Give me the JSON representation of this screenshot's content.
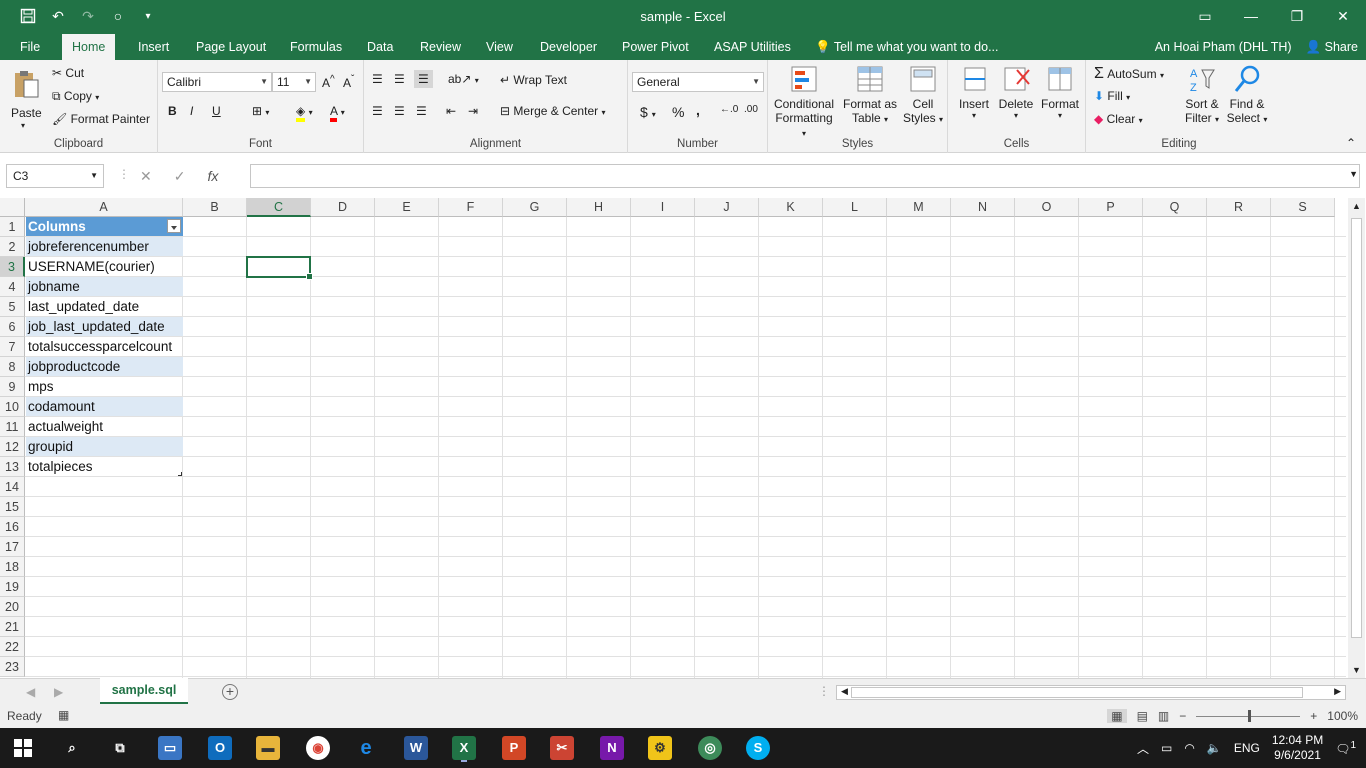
{
  "window": {
    "title": "sample - Excel"
  },
  "tabs": [
    "File",
    "Home",
    "Insert",
    "Page Layout",
    "Formulas",
    "Data",
    "Review",
    "View",
    "Developer",
    "Power Pivot",
    "ASAP Utilities"
  ],
  "tell_me": "Tell me what you want to do...",
  "user": "An Hoai Pham (DHL TH)",
  "share": "Share",
  "ribbon": {
    "clipboard": {
      "label": "Clipboard",
      "paste": "Paste",
      "cut": "Cut",
      "copy": "Copy",
      "format_painter": "Format Painter"
    },
    "font": {
      "label": "Font",
      "name": "Calibri",
      "size": "11",
      "bold": "B",
      "italic": "I",
      "underline": "U"
    },
    "alignment": {
      "label": "Alignment",
      "wrap_text": "Wrap Text",
      "merge_center": "Merge & Center"
    },
    "number": {
      "label": "Number",
      "format": "General",
      "currency": "$",
      "percent": "%",
      "comma": ","
    },
    "styles": {
      "label": "Styles",
      "conditional": "Conditional",
      "formatting": "Formatting",
      "format_as": "Format as",
      "table": "Table",
      "cell": "Cell",
      "styles": "Styles"
    },
    "cells": {
      "label": "Cells",
      "insert": "Insert",
      "delete": "Delete",
      "format": "Format"
    },
    "editing": {
      "label": "Editing",
      "autosum": "AutoSum",
      "fill": "Fill",
      "clear": "Clear",
      "sort": "Sort &",
      "filter": "Filter",
      "find": "Find &",
      "select": "Select"
    }
  },
  "formula_bar": {
    "name_box": "C3",
    "fx": "fx",
    "value": ""
  },
  "columns": [
    "A",
    "B",
    "C",
    "D",
    "E",
    "F",
    "G",
    "H",
    "I",
    "J",
    "K",
    "L",
    "M",
    "N",
    "O",
    "P",
    "Q",
    "R",
    "S"
  ],
  "rows": [
    "1",
    "2",
    "3",
    "4",
    "5",
    "6",
    "7",
    "8",
    "9",
    "10",
    "11",
    "12",
    "13",
    "14",
    "15",
    "16",
    "17",
    "18",
    "19",
    "20",
    "21",
    "22",
    "23"
  ],
  "table": {
    "header": "Columns",
    "values": [
      "jobreferencenumber",
      "USERNAME(courier)",
      "jobname",
      "last_updated_date",
      "job_last_updated_date",
      "totalsuccessparcelcount",
      "jobproductcode",
      "mps",
      "codamount",
      "actualweight",
      "groupid",
      "totalpieces"
    ]
  },
  "sheet_tab": "sample.sql",
  "status": {
    "ready": "Ready",
    "zoom": "100%"
  },
  "taskbar": {
    "lang": "ENG",
    "time": "12:04 PM",
    "date": "9/6/2021",
    "notifications": "1"
  }
}
